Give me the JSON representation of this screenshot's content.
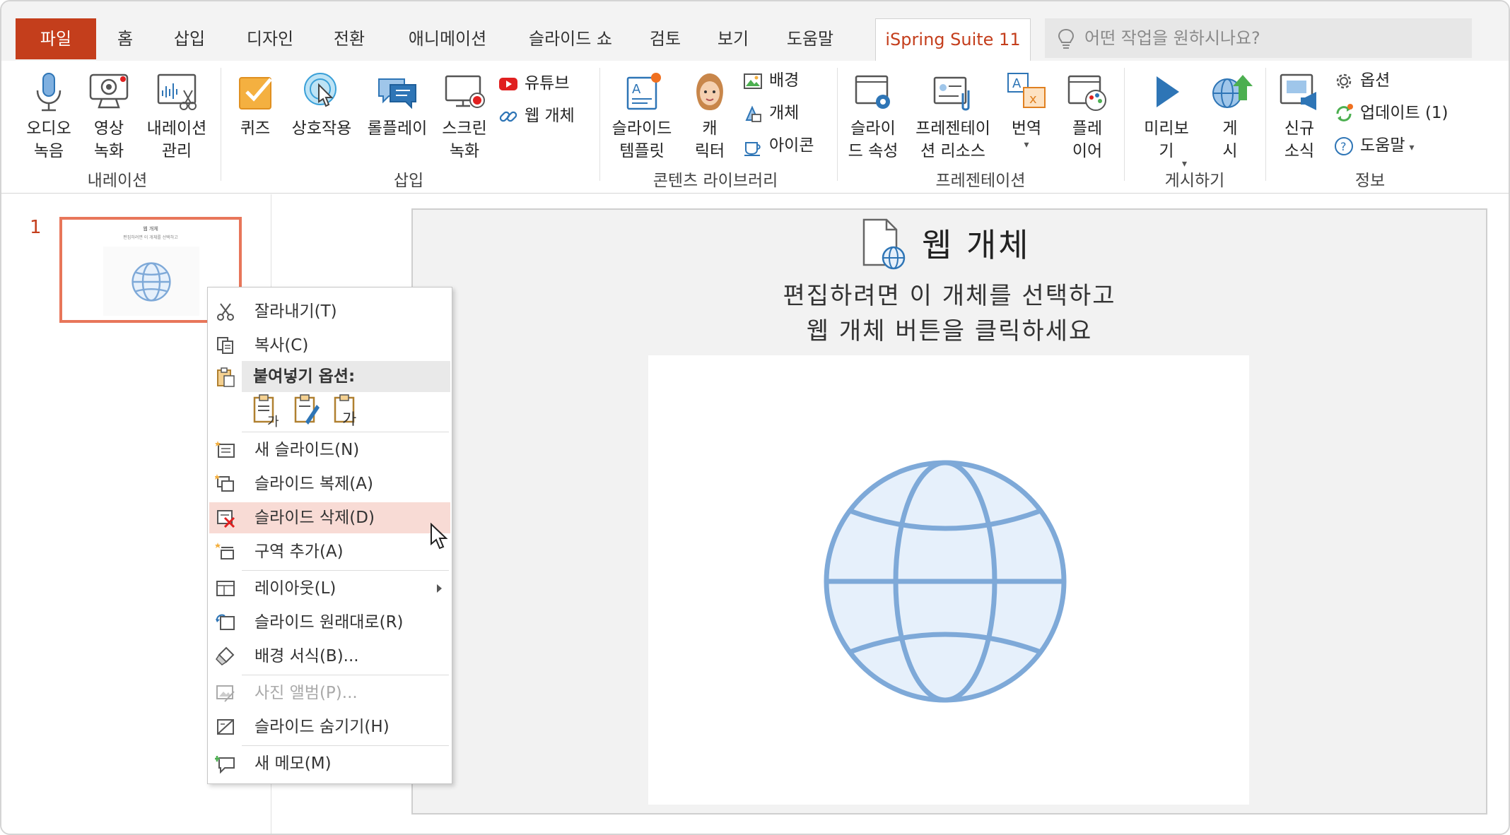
{
  "tabs": [
    {
      "label": "파일",
      "type": "file"
    },
    {
      "label": "홈"
    },
    {
      "label": "삽입"
    },
    {
      "label": "디자인"
    },
    {
      "label": "전환"
    },
    {
      "label": "애니메이션"
    },
    {
      "label": "슬라이드 쇼"
    },
    {
      "label": "검토"
    },
    {
      "label": "보기"
    },
    {
      "label": "도움말"
    },
    {
      "label": "iSpring Suite 11",
      "type": "active"
    }
  ],
  "tell_me": {
    "placeholder": "어떤 작업을 원하시나요?"
  },
  "ribbon": {
    "groups": {
      "narration": "내레이션",
      "insert": "삽입",
      "content_library": "콘텐츠 라이브러리",
      "presentation": "프레젠테이션",
      "publish": "게시하기",
      "info": "정보"
    },
    "buttons": {
      "audio": "오디오\n녹음",
      "video": "영상\n녹화",
      "narration_manage": "내레이션\n관리",
      "quiz": "퀴즈",
      "interaction": "상호작용",
      "roleplay": "롤플레이",
      "screen_record": "스크린\n녹화",
      "youtube": "유튜브",
      "web_object": "웹 개체",
      "slide_templates": "슬라이드\n템플릿",
      "character": "캐\n릭터",
      "background": "배경",
      "object": "개체",
      "icons": "아이콘",
      "slide_props": "슬라이\n드 속성",
      "pres_resources": "프레젠테이\n션 리소스",
      "translate": "번역",
      "player": "플레\n이어",
      "preview": "미리보\n기",
      "publish": "게\n시",
      "news": "신규\n소식",
      "options": "옵션",
      "update": "업데이트 (1)",
      "help": "도움말"
    },
    "colors": {
      "accent": "#c43e1c",
      "icon_blue": "#2e75b6",
      "icon_orange": "#f0a030"
    }
  },
  "thumbnail": {
    "number": "1"
  },
  "slide": {
    "placeholder_title": "웹 개체",
    "instruction_line1": "편집하려면 이 개체를 선택하고",
    "instruction_line2": "웹 개체 버튼을 클릭하세요"
  },
  "context_menu": {
    "cut": "잘라내기(T)",
    "copy": "복사(C)",
    "paste_header": "붙여넣기 옵션:",
    "new_slide": "새 슬라이드(N)",
    "duplicate_slide": "슬라이드 복제(A)",
    "delete_slide": "슬라이드 삭제(D)",
    "add_section": "구역 추가(A)",
    "layout": "레이아웃(L)",
    "reset_slide": "슬라이드 원래대로(R)",
    "format_background": "배경 서식(B)...",
    "photo_album": "사진 앨범(P)...",
    "hide_slide": "슬라이드 숨기기(H)",
    "new_comment": "새 메모(M)"
  }
}
